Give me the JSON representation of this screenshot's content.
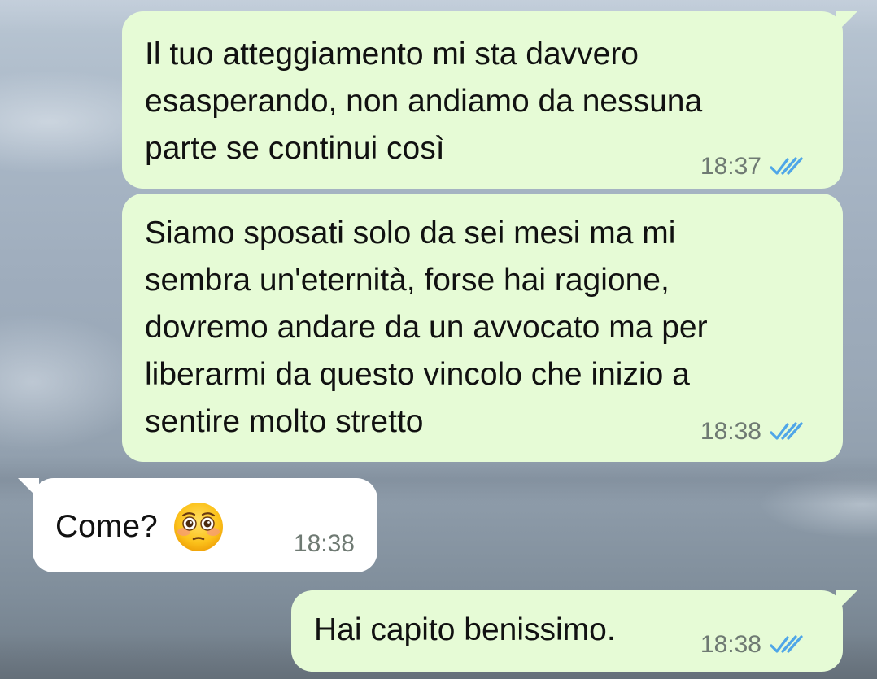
{
  "messages": [
    {
      "direction": "outgoing",
      "text": "Il tuo atteggiamento mi sta davvero\nesasperando, non andiamo da nessuna\nparte se continui così",
      "time": "18:37",
      "status_icon": "double-check-read-icon"
    },
    {
      "direction": "outgoing",
      "text": "Siamo sposati solo da sei mesi ma mi\nsembra un'eternità, forse hai ragione,\ndovremo andare da un avvocato ma per\nliberarmi da questo vincolo che inizio a\nsentire molto stretto",
      "time": "18:38",
      "status_icon": "double-check-read-icon"
    },
    {
      "direction": "incoming",
      "text": "Come?",
      "emoji": "flushed-face-emoji",
      "time": "18:38"
    },
    {
      "direction": "outgoing",
      "text": "Hai capito benissimo.",
      "time": "18:38",
      "status_icon": "double-check-read-icon"
    }
  ],
  "colors": {
    "outgoing_bubble": "#e6fbd6",
    "incoming_bubble": "#ffffff",
    "read_ticks": "#4fa6e8",
    "timestamp": "#6f7a73"
  }
}
